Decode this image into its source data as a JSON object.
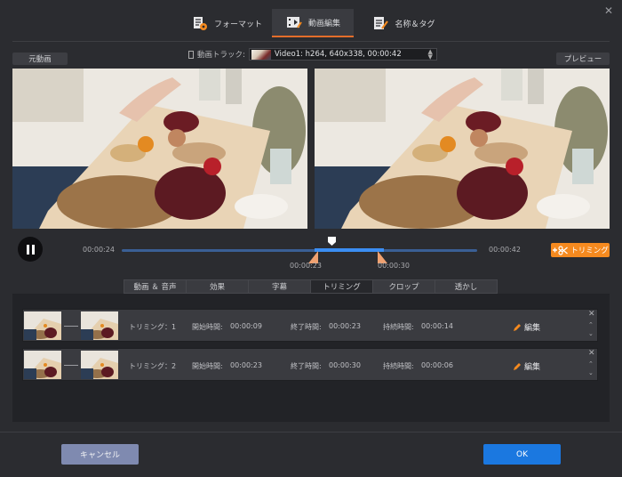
{
  "tabs": [
    {
      "label": "フォーマット",
      "icon": "format-icon"
    },
    {
      "label": "動画編集",
      "icon": "video-edit-icon"
    },
    {
      "label": "名称＆タグ",
      "icon": "name-tag-icon"
    }
  ],
  "active_tab": 1,
  "labels": {
    "source": "元動画",
    "preview": "プレビュー"
  },
  "track": {
    "label": "動画トラック:",
    "value": "Video1: h264, 640x338, 00:00:42"
  },
  "player": {
    "current_time": "00:00:24",
    "total_time": "00:00:42",
    "selection_start": "00:00:23",
    "selection_end": "00:00:30",
    "trim_button": "トリミング"
  },
  "subtabs": [
    "動画 ＆ 音声",
    "効果",
    "字幕",
    "トリミング",
    "クロップ",
    "透かし"
  ],
  "active_subtab": 3,
  "clips": [
    {
      "name": "トリミング：1",
      "start_label": "開始時間:",
      "start": "00:00:09",
      "end_label": "終了時間:",
      "end": "00:00:23",
      "dur_label": "持続時間:",
      "dur": "00:00:14",
      "edit": "編集"
    },
    {
      "name": "トリミング：2",
      "start_label": "開始時間:",
      "start": "00:00:23",
      "end_label": "終了時間:",
      "end": "00:00:30",
      "dur_label": "持続時間:",
      "dur": "00:00:06",
      "edit": "編集"
    }
  ],
  "footer": {
    "cancel": "キャンセル",
    "ok": "OK"
  },
  "colors": {
    "accent": "#f58a1f",
    "tab_underline": "#e36d2a",
    "ok": "#1b78e0",
    "cancel": "#7f8ab0",
    "timeline": "#3b8ef3"
  }
}
